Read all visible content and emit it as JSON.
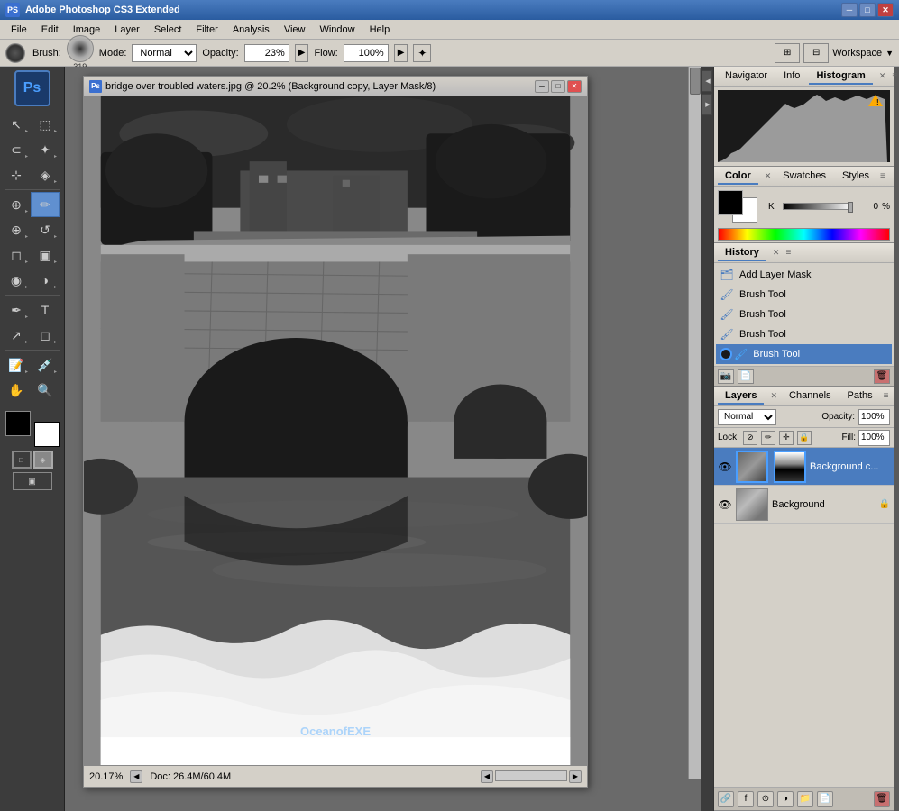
{
  "app": {
    "title": "Adobe Photoshop CS3 Extended",
    "title_icon": "PS"
  },
  "titlebar": {
    "title": "Adobe Photoshop CS3 Extended",
    "minimize": "─",
    "maximize": "□",
    "close": "✕"
  },
  "menubar": {
    "items": [
      "File",
      "Edit",
      "Image",
      "Layer",
      "Select",
      "Filter",
      "Analysis",
      "View",
      "Window",
      "Help"
    ]
  },
  "optionsbar": {
    "brush_label": "Brush:",
    "brush_size": "319",
    "mode_label": "Mode:",
    "mode_value": "Normal",
    "opacity_label": "Opacity:",
    "opacity_value": "23%",
    "flow_label": "Flow:",
    "flow_value": "100%",
    "workspace_label": "Workspace"
  },
  "document": {
    "title": "bridge over troubled waters.jpg @ 20.2% (Background copy, Layer Mask/8)",
    "icon": "PS",
    "zoom": "20.17%",
    "doc_size": "Doc: 26.4M/60.4M",
    "minimize": "─",
    "maximize": "□",
    "close": "✕"
  },
  "panels": {
    "histogram": {
      "tabs": [
        "Navigator",
        "Info",
        "Histogram"
      ],
      "active_tab": "Histogram"
    },
    "color": {
      "tabs": [
        "Color",
        "Swatches",
        "Styles"
      ],
      "active_tab": "Color",
      "k_label": "K",
      "k_value": "0",
      "pct": "%"
    },
    "history": {
      "tabs": [
        "History"
      ],
      "active_tab": "History",
      "items": [
        {
          "label": "Add Layer Mask",
          "icon": "🗂",
          "active": false
        },
        {
          "label": "Brush Tool",
          "icon": "🖌",
          "active": false
        },
        {
          "label": "Brush Tool",
          "icon": "🖌",
          "active": false
        },
        {
          "label": "Brush Tool",
          "icon": "🖌",
          "active": false
        },
        {
          "label": "Brush Tool",
          "icon": "🖌",
          "active": true
        }
      ]
    },
    "layers": {
      "tabs": [
        "Layers",
        "Channels",
        "Paths"
      ],
      "active_tab": "Layers",
      "blend_mode": "Normal",
      "opacity_label": "Opacity:",
      "opacity_value": "100%",
      "lock_label": "Lock:",
      "fill_label": "Fill:",
      "fill_value": "100%",
      "items": [
        {
          "name": "Background c...",
          "active": true,
          "has_mask": true,
          "lock_icon": false
        },
        {
          "name": "Background",
          "active": false,
          "has_mask": false,
          "lock_icon": true
        }
      ]
    }
  },
  "toolbox": {
    "tools": [
      {
        "name": "move-tool",
        "icon": "↖",
        "label": "Move Tool"
      },
      {
        "name": "marquee-tool",
        "icon": "⬚",
        "label": "Marquee"
      },
      {
        "name": "lasso-tool",
        "icon": "⌇",
        "label": "Lasso"
      },
      {
        "name": "magic-wand",
        "icon": "✦",
        "label": "Magic Wand"
      },
      {
        "name": "crop-tool",
        "icon": "⊹",
        "label": "Crop"
      },
      {
        "name": "eyedropper",
        "icon": "🔬",
        "label": "Eyedropper"
      },
      {
        "name": "heal-tool",
        "icon": "⊕",
        "label": "Healing"
      },
      {
        "name": "brush-tool",
        "icon": "✏",
        "label": "Brush",
        "active": true
      },
      {
        "name": "clone-tool",
        "icon": "⊕",
        "label": "Clone"
      },
      {
        "name": "history-brush",
        "icon": "↺",
        "label": "History Brush"
      },
      {
        "name": "eraser-tool",
        "icon": "◻",
        "label": "Eraser"
      },
      {
        "name": "gradient-tool",
        "icon": "▣",
        "label": "Gradient"
      },
      {
        "name": "blur-tool",
        "icon": "◉",
        "label": "Blur"
      },
      {
        "name": "dodge-tool",
        "icon": "◑",
        "label": "Dodge"
      },
      {
        "name": "pen-tool",
        "icon": "✒",
        "label": "Pen"
      },
      {
        "name": "type-tool",
        "icon": "T",
        "label": "Type"
      },
      {
        "name": "path-select",
        "icon": "↗",
        "label": "Path Select"
      },
      {
        "name": "shape-tool",
        "icon": "◻",
        "label": "Shape"
      },
      {
        "name": "notes-tool",
        "icon": "📝",
        "label": "Notes"
      },
      {
        "name": "eyedropper2",
        "icon": "💉",
        "label": "Eyedropper"
      },
      {
        "name": "hand-tool",
        "icon": "✋",
        "label": "Hand"
      },
      {
        "name": "zoom-tool",
        "icon": "🔍",
        "label": "Zoom"
      }
    ],
    "fg_color": "black",
    "bg_color": "white"
  },
  "watermark": "OceanofEXE"
}
